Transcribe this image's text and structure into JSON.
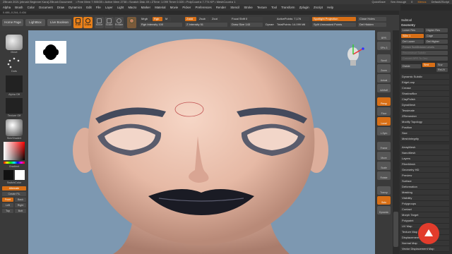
{
  "titlebar": {
    "title": "ZBrush 2021 [zbrush Beginner Kara]   ZBrush Document",
    "stats": "• Free Mem 7.905GB • Active Mem 2738 • Scratch Disk 49 • ZTime: 1.099 Timer 0.020 • PolyCount ▸ 7.774 KP • MeshCount ▸ 1",
    "quicksave": "QuickSave",
    "seethrough": "See-through",
    "see_value": "0",
    "menus_label": "Menus",
    "defaultscript": "DefaultZScript"
  },
  "menubar": [
    "Alpha",
    "Brush",
    "Color",
    "Document",
    "Draw",
    "Dynamics",
    "Edit",
    "File",
    "Layer",
    "Light",
    "Macro",
    "Marker",
    "Material",
    "Movie",
    "Picker",
    "Preferences",
    "Render",
    "Stencil",
    "Stroke",
    "Texture",
    "Tool",
    "Transform",
    "Zplugin",
    "Zscript",
    "Help"
  ],
  "coords": "0.488,-0.244,-0.434",
  "topshelf": {
    "home": "Home Page",
    "lightbox": "LightBox",
    "live_boolean": "Live Boolean",
    "edit": "Edit",
    "draw": "Draw",
    "move": "Move",
    "scale": "Scale",
    "rotate": "Rotate",
    "mrgb": "Mrgb",
    "rgb": "Rgb",
    "m": "M",
    "rgb_intensity": "Rgb Intensity 100",
    "zadd": "Zadd",
    "zsub": "Zsub",
    "zcut": "Zcut",
    "z_intensity": "Z Intensity 51",
    "focal_shift": "Focal Shift 0",
    "draw_size": "Draw Size 143",
    "dynamic": "Dynamic",
    "active_points": "ActivePoints: 7,176",
    "total_points": "TotalPoints: 14.099 Mil",
    "spotlight": "Spotlight Projection",
    "sphere": "Split Unmasked Points",
    "close_holes": "Close Holes",
    "del_hidden": "Del Hidden"
  },
  "leftpanel": {
    "move": "Move",
    "dots": "Dots",
    "alpha_off": "Alpha Off",
    "texture_off": "Texture Off",
    "material": "SkinShade4",
    "gradient": "Gradient",
    "switch_color": "SwitchColor",
    "alternate": "Alternate",
    "create_fill": "Create FIL",
    "front": "Front",
    "back": "Back",
    "left": "Left",
    "right": "Right",
    "top": "Top",
    "bottom": "Bott"
  },
  "navtray": [
    "BPR",
    "SPix 3",
    "Scroll",
    "Zoom",
    "Actual",
    "AAHalf",
    "Persp",
    "Floor",
    "Local",
    "L.Sym",
    "Frame",
    "Move",
    "Scale",
    "Rotate",
    "Transp",
    "Solo",
    "Dynamic"
  ],
  "rightpanel": {
    "subtool": "Subtool",
    "geometry": "Geometry",
    "lower_res": "Lower Res",
    "higher_res": "Higher Res",
    "sdiv": "SDiv 1",
    "cage": "Cage",
    "del_lower": "Del Lower",
    "del_higher": "Del Higher",
    "freeze": "Freeze SubDivision Levels",
    "reconstruct": "Reconstruct Subdiv",
    "convert": "Convert BPR To Geo",
    "divide": "Divide",
    "smt": "Smt",
    "suv": "Suv",
    "relax": "ReUV",
    "items": [
      "Dynamic Subdiv",
      "EdgeLoop",
      "Crease",
      "ShadowBox",
      "ClayPolish",
      "DynaMesh",
      "Tessimate",
      "ZRemesher",
      "Modify Topology",
      "Position",
      "Size",
      "MeshIntegrity"
    ],
    "items2": [
      "ArrayMesh",
      "NanoMesh",
      "Layers",
      "FiberMesh",
      "Geometry HD",
      "Preview",
      "Surface",
      "Deformation",
      "Masking",
      "Visibility",
      "Polygroups",
      "Contact",
      "Morph Target",
      "Polypaint",
      "UV Map",
      "Texture Map",
      "Displacement Map",
      "Normal Map",
      "Vector Displacement Map"
    ]
  },
  "canvas": {
    "corner_thumbnail": "head silhouette"
  },
  "colors": {
    "accent": "#e8801a",
    "canvas_bg": "#7d98b1",
    "skin": "#e8c2b0"
  }
}
